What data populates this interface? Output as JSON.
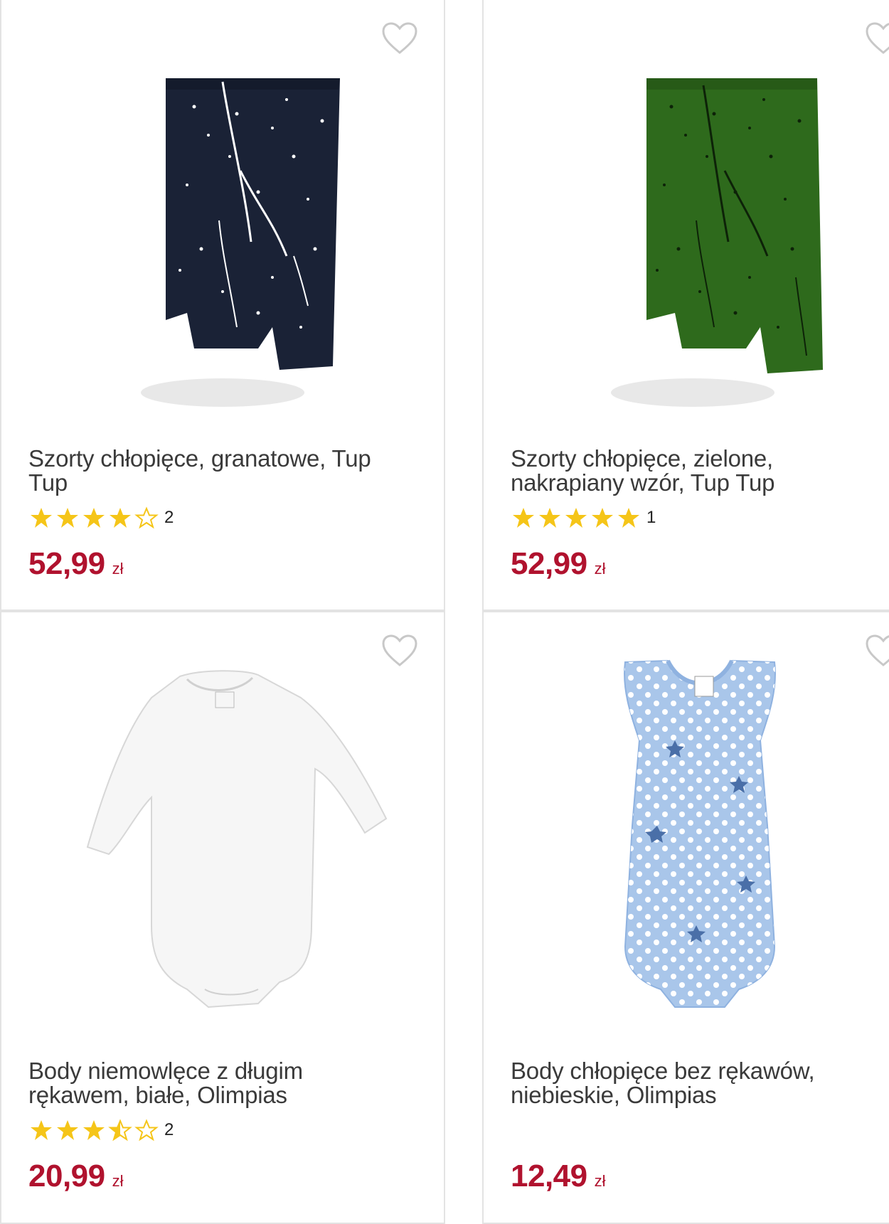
{
  "products": [
    {
      "title": "Szorty chłopięce, granatowe, Tup Tup",
      "title_line1": "Szorty chłopięce, granatowe, Tup",
      "title_line2": "Tup",
      "rating": 4,
      "rating_count": "2",
      "price": "52,99",
      "currency": "zł",
      "image": "navy-shorts"
    },
    {
      "title": "Szorty chłopięce, zielone, nakrapiany wzór, Tup Tup",
      "title_line1": "Szorty chłopięce, zielone,",
      "title_line2": "nakrapiany wzór, Tup Tup",
      "rating": 5,
      "rating_count": "1",
      "price": "52,99",
      "currency": "zł",
      "image": "green-shorts"
    },
    {
      "title": "Body niemowlęce z długim rękawem, białe, Olimpias",
      "title_line1": "Body niemowlęce z długim",
      "title_line2": "rękawem, białe, Olimpias",
      "rating": 3.5,
      "rating_count": "2",
      "price": "20,99",
      "currency": "zł",
      "image": "white-bodysuit"
    },
    {
      "title": "Body chłopięce bez rękawów, niebieskie, Olimpias",
      "title_line1": "Body chłopięce bez rękawów,",
      "title_line2": "niebieskie, Olimpias",
      "price": "12,49",
      "currency": "zł",
      "image": "blue-bodysuit"
    }
  ],
  "colors": {
    "price": "#b0122e",
    "star": "#f5c518",
    "border": "#e3e3e3"
  },
  "icons": {
    "favorite": "heart-outline-icon",
    "star_full": "star-filled-icon",
    "star_half": "star-half-icon",
    "star_empty": "star-outline-icon"
  }
}
